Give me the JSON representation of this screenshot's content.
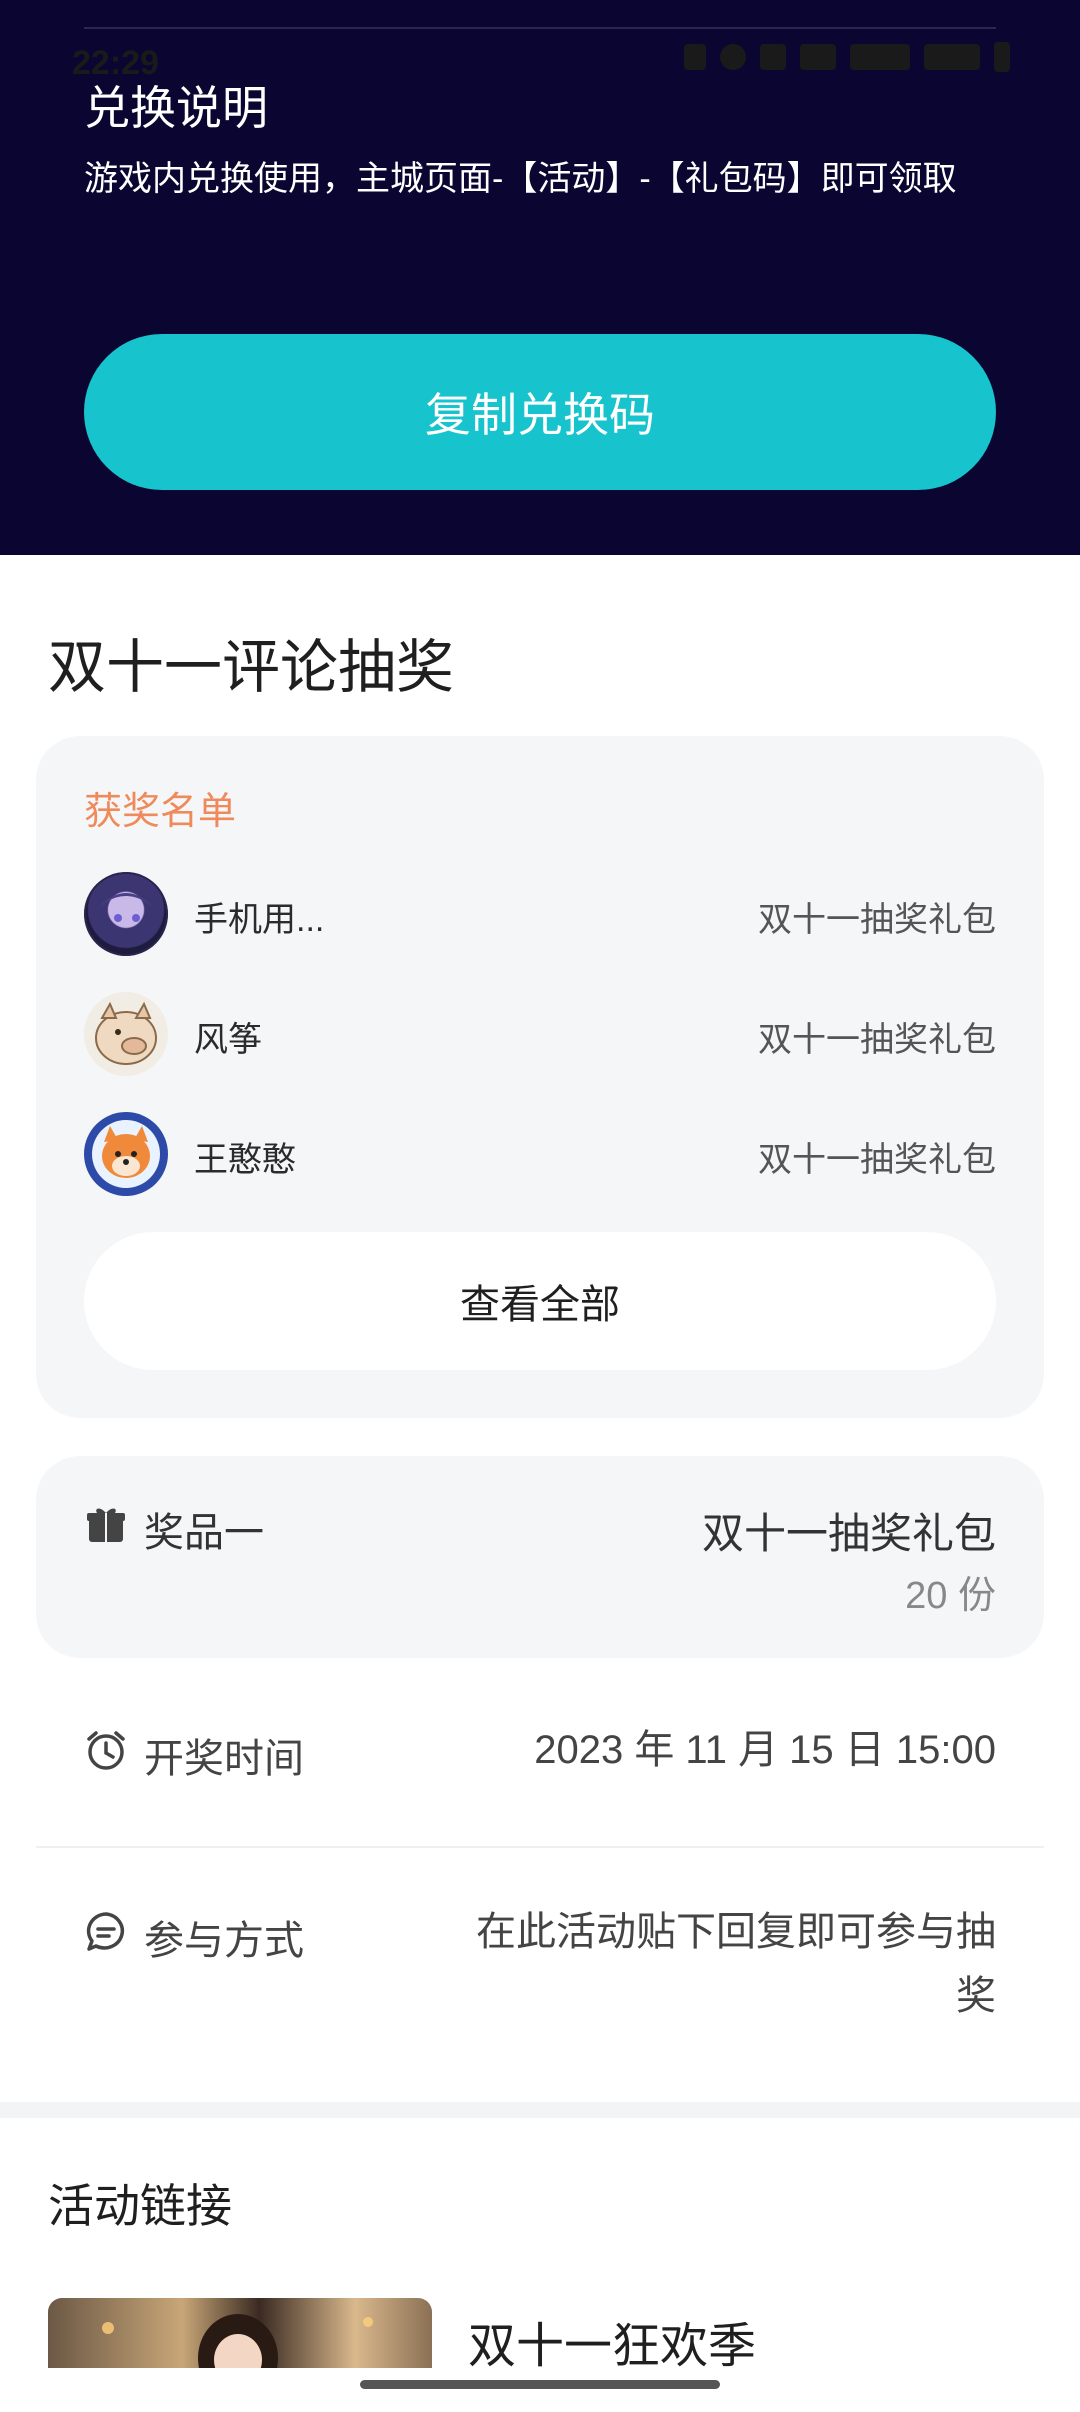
{
  "status_bar": {
    "time": "22:29"
  },
  "redeem": {
    "title": "兑换说明",
    "description": "游戏内兑换使用，主城页面-【活动】-【礼包码】即可领取",
    "copy_button": "复制兑换码"
  },
  "lottery": {
    "title": "双十一评论抽奖",
    "winners_title": "获奖名单",
    "winners": [
      {
        "name": "手机用...",
        "prize": "双十一抽奖礼包",
        "avatar": "anime-avatar"
      },
      {
        "name": "风筝",
        "prize": "双十一抽奖礼包",
        "avatar": "pig-avatar"
      },
      {
        "name": "王憨憨",
        "prize": "双十一抽奖礼包",
        "avatar": "dog-avatar"
      }
    ],
    "view_all": "查看全部",
    "prize": {
      "label": "奖品一",
      "name": "双十一抽奖礼包",
      "quantity": "20 份",
      "icon": "gift-icon"
    },
    "draw_time": {
      "label": "开奖时间",
      "value": "2023 年 11 月 15 日 15:00",
      "icon": "alarm-icon"
    },
    "participation": {
      "label": "参与方式",
      "value_line1": "在此活动贴下回复即可参与抽",
      "value_line2": "奖",
      "icon": "chat-icon"
    }
  },
  "activity_links": {
    "title": "活动链接",
    "items": [
      {
        "name": "双十一狂欢季"
      }
    ]
  },
  "colors": {
    "header_bg": "#0b0631",
    "accent_button": "#17c3cc",
    "winners_title": "#ef8a5b",
    "card_bg": "#f5f6f8"
  }
}
